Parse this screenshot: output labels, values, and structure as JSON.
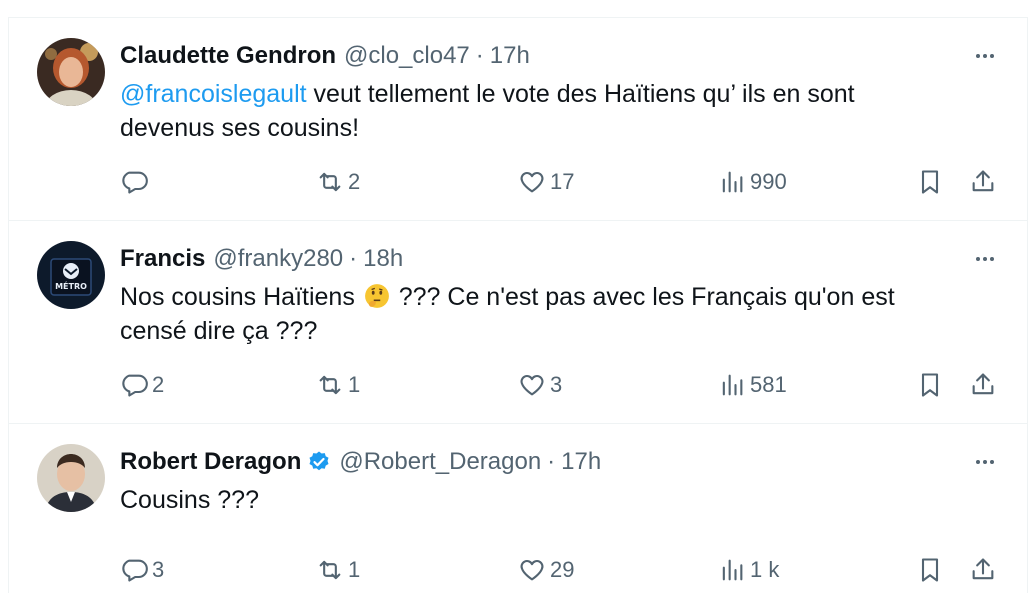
{
  "tweets": [
    {
      "name": "Claudette Gendron",
      "handle": "@clo_clo47",
      "time": "17h",
      "mention": "@francoislegault",
      "text_line1": " veut tellement le vote des Haïtiens qu’ ils en sont",
      "text_line2": "devenus ses cousins!",
      "replies": "",
      "retweets": "2",
      "likes": "17",
      "views": "990",
      "verified": false,
      "avatar_icon": "avatar-woman-photo"
    },
    {
      "name": "Francis",
      "handle": "@franky280",
      "time": "18h",
      "text_line1_a": "Nos cousins Haïtiens ",
      "emoji": "thinking-face-emoji",
      "text_line1_b": " ??? Ce n'est pas avec les Français qu'on est",
      "text_line2": "censé dire ça ???",
      "replies": "2",
      "retweets": "1",
      "likes": "3",
      "views": "581",
      "verified": false,
      "avatar_icon": "avatar-metro-sign",
      "avatar_text": "MÉTRO"
    },
    {
      "name": "Robert Deragon",
      "handle": "@Robert_Deragon",
      "time": "17h",
      "text_line1": "Cousins ???",
      "replies": "3",
      "retweets": "1",
      "likes": "29",
      "views": "1 k",
      "verified": true,
      "avatar_icon": "avatar-man-photo"
    }
  ],
  "separator": "·",
  "colors": {
    "text": "#0f1419",
    "secondary": "#536471",
    "accent": "#1d9bf0",
    "border": "#eff3f4"
  }
}
